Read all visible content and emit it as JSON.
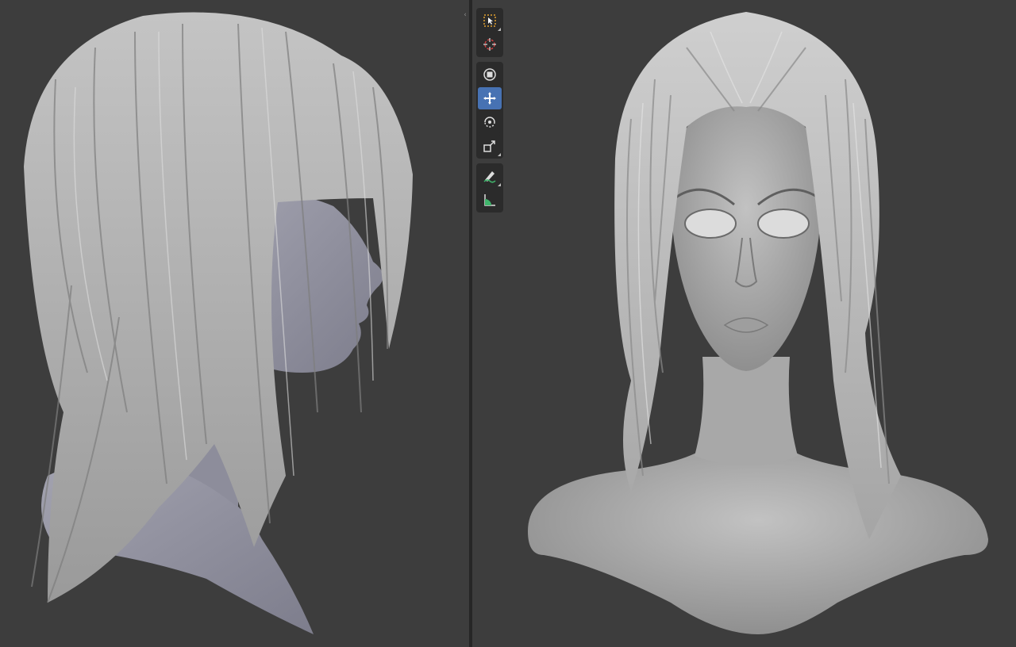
{
  "viewports": {
    "left": {
      "content": "sculpt-profile-view"
    },
    "right": {
      "content": "sculpt-front-view"
    }
  },
  "toolbar": {
    "groups": [
      [
        {
          "name": "select-box",
          "icon": "select-box-icon",
          "active": false
        },
        {
          "name": "cursor",
          "icon": "cursor-icon",
          "active": false
        }
      ],
      [
        {
          "name": "transform",
          "icon": "transform-icon",
          "active": false
        },
        {
          "name": "move",
          "icon": "move-icon",
          "active": true
        },
        {
          "name": "rotate",
          "icon": "rotate-icon",
          "active": false
        },
        {
          "name": "scale",
          "icon": "scale-icon",
          "active": false
        }
      ],
      [
        {
          "name": "annotate",
          "icon": "annotate-icon",
          "active": false
        },
        {
          "name": "measure",
          "icon": "measure-icon",
          "active": false
        }
      ]
    ]
  },
  "colors": {
    "viewport_bg": "#3d3d3d",
    "divider": "#262626",
    "toolbar_bg": "#2b2b2b",
    "active_tool": "#4772b3",
    "clay_profile": "#8e8e9c",
    "clay_front": "#b3b3b3"
  }
}
